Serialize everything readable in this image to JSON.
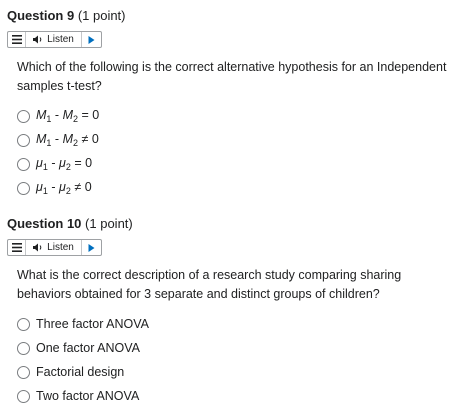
{
  "questions": [
    {
      "title": "Question 9",
      "points": "(1 point)",
      "listen_label": "Listen",
      "text": "Which of the following is the correct alternative hypothesis for an Independent samples t-test?",
      "options": [
        {
          "var": "M",
          "sub1": "1",
          "op": "-",
          "sub2": "2",
          "rel": "=",
          "val": "0"
        },
        {
          "var": "M",
          "sub1": "1",
          "op": "-",
          "sub2": "2",
          "rel": "≠",
          "val": "0"
        },
        {
          "var": "μ",
          "sub1": "1",
          "op": "-",
          "sub2": "2",
          "rel": "=",
          "val": "0"
        },
        {
          "var": "μ",
          "sub1": "1",
          "op": "-",
          "sub2": "2",
          "rel": "≠",
          "val": "0"
        }
      ]
    },
    {
      "title": "Question 10",
      "points": "(1 point)",
      "listen_label": "Listen",
      "text": "What is the correct description of a research study comparing sharing behaviors obtained for 3 separate and distinct groups of children?",
      "options": [
        {
          "label": "Three factor ANOVA"
        },
        {
          "label": "One factor ANOVA"
        },
        {
          "label": "Factorial design"
        },
        {
          "label": "Two factor ANOVA"
        }
      ]
    }
  ],
  "icons": {
    "menu": "menu-icon",
    "speaker": "speaker-icon",
    "play": "play-icon"
  },
  "colors": {
    "play_accent": "#006fbf",
    "text": "#202122",
    "border": "#9ea1a4"
  }
}
